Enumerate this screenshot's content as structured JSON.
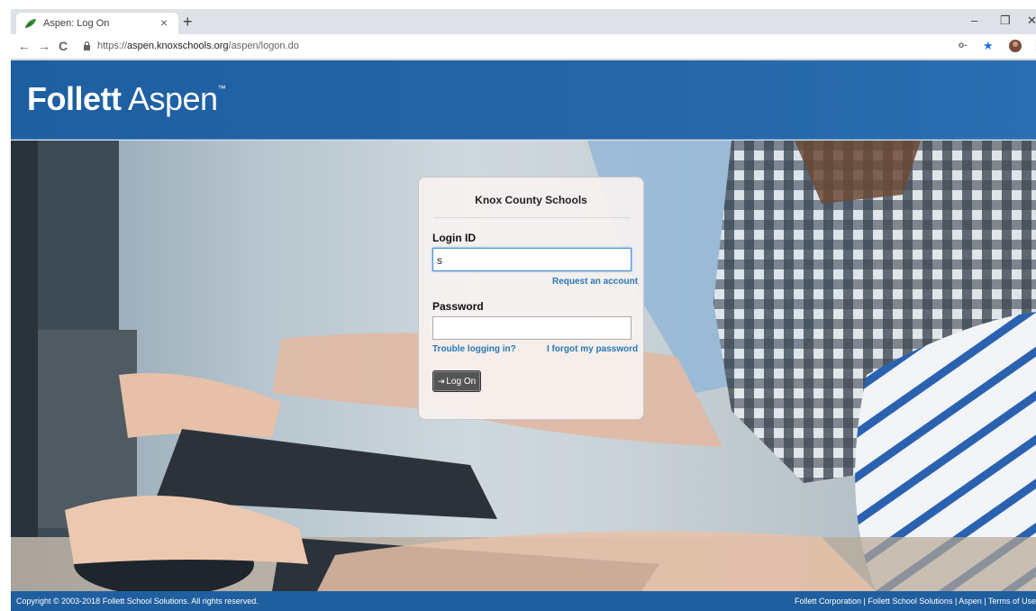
{
  "browser": {
    "tab_title": "Aspen: Log On",
    "tab_close": "×",
    "new_tab": "+",
    "url_scheme": "https://",
    "url_host": "aspen.knoxschools.org",
    "url_path": "/aspen/logon.do",
    "back": "←",
    "forward": "→",
    "reload": "C",
    "minimize": "–",
    "restore": "❐",
    "close": "✕",
    "key_icon": "o-",
    "star_icon": "★",
    "menu_icon": "⋮"
  },
  "banner": {
    "brand_bold": "Follett",
    "brand_light": "Aspen",
    "brand_tm": "™"
  },
  "login": {
    "organization": "Knox County Schools",
    "login_id_label": "Login ID",
    "login_id_value": "s",
    "request_account": "Request an account",
    "password_label": "Password",
    "password_value": "",
    "trouble_link": "Trouble logging in?",
    "forgot_link": "I forgot my password",
    "logon_button": "Log On",
    "logon_icon": "⇥"
  },
  "footer": {
    "copyright": "Copyright © 2003-2018 Follett School Solutions. All rights reserved.",
    "links": "Follett Corporation | Follett School Solutions | Aspen | Terms of Use"
  },
  "colors": {
    "banner_blue": "#1d5fa1",
    "footer_blue": "#1f5f9f",
    "link_blue": "#2a78b8",
    "button_gray": "#555555"
  }
}
